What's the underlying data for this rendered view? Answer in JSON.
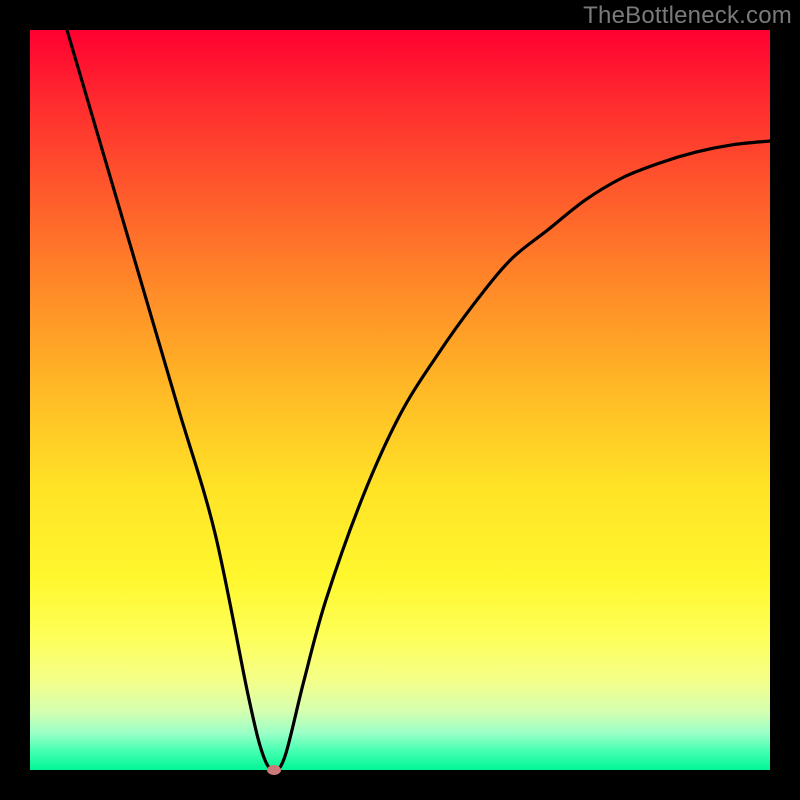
{
  "watermark": "TheBottleneck.com",
  "colors": {
    "frame": "#000000",
    "curve": "#000000",
    "marker": "#ca7b79",
    "gradient_top": "#ff0030",
    "gradient_bottom": "#00f596"
  },
  "chart_data": {
    "type": "line",
    "title": "",
    "xlabel": "",
    "ylabel": "",
    "xlim": [
      0,
      1
    ],
    "ylim": [
      0,
      1
    ],
    "series": [
      {
        "name": "bottleneck-curve",
        "x": [
          0.05,
          0.1,
          0.15,
          0.2,
          0.25,
          0.295,
          0.315,
          0.33,
          0.345,
          0.37,
          0.4,
          0.45,
          0.5,
          0.55,
          0.6,
          0.65,
          0.7,
          0.75,
          0.8,
          0.85,
          0.9,
          0.95,
          1.0
        ],
        "y": [
          1.0,
          0.83,
          0.66,
          0.49,
          0.32,
          0.1,
          0.02,
          0.0,
          0.02,
          0.12,
          0.23,
          0.37,
          0.48,
          0.56,
          0.63,
          0.69,
          0.73,
          0.77,
          0.8,
          0.82,
          0.835,
          0.845,
          0.85
        ]
      }
    ],
    "annotations": [
      {
        "name": "minimum-marker",
        "x": 0.33,
        "y": 0.0
      }
    ]
  }
}
